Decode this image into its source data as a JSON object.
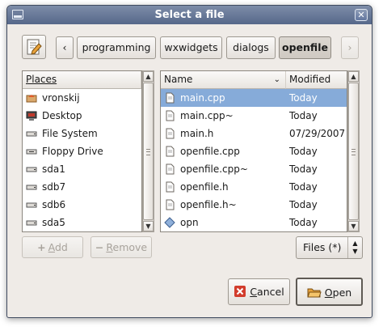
{
  "window": {
    "title": "Select a file",
    "close_glyph": "✕"
  },
  "path_bar": {
    "nav_left": "‹",
    "nav_right": "›",
    "crumbs": [
      {
        "label": "programming"
      },
      {
        "label": "wxwidgets"
      },
      {
        "label": "dialogs"
      },
      {
        "label": "openfile",
        "active": true
      }
    ]
  },
  "places": {
    "header": "Places",
    "items": [
      {
        "label": "vronskij",
        "icon": "home-folder-icon"
      },
      {
        "label": "Desktop",
        "icon": "desktop-icon"
      },
      {
        "label": "File System",
        "icon": "drive-icon"
      },
      {
        "label": "Floppy Drive",
        "icon": "floppy-icon"
      },
      {
        "label": "sda1",
        "icon": "drive-icon"
      },
      {
        "label": "sdb7",
        "icon": "drive-icon"
      },
      {
        "label": "sdb6",
        "icon": "drive-icon"
      },
      {
        "label": "sda5",
        "icon": "drive-icon"
      }
    ]
  },
  "files": {
    "col_name": "Name",
    "col_modified": "Modified",
    "rows": [
      {
        "name": "main.cpp",
        "modified": "Today",
        "selected": true,
        "icon": "document-icon"
      },
      {
        "name": "main.cpp~",
        "modified": "Today",
        "icon": "document-icon"
      },
      {
        "name": "main.h",
        "modified": "07/29/2007",
        "icon": "document-icon"
      },
      {
        "name": "openfile.cpp",
        "modified": "Today",
        "icon": "document-icon"
      },
      {
        "name": "openfile.cpp~",
        "modified": "Today",
        "icon": "document-icon"
      },
      {
        "name": "openfile.h",
        "modified": "Today",
        "icon": "document-icon"
      },
      {
        "name": "openfile.h~",
        "modified": "Today",
        "icon": "document-icon"
      },
      {
        "name": "opn",
        "modified": "Today",
        "icon": "executable-icon"
      }
    ]
  },
  "buttons": {
    "add_m": "A",
    "add_rest": "dd",
    "remove_m": "R",
    "remove_rest": "emove",
    "cancel_m": "C",
    "cancel_rest": "ancel",
    "open_m": "O",
    "open_rest": "pen"
  },
  "filter": {
    "selected": "Files (*)"
  },
  "colors": {
    "selection": "#86abd9",
    "titlebar": "#5d6f93",
    "window_bg": "#efebe7"
  }
}
